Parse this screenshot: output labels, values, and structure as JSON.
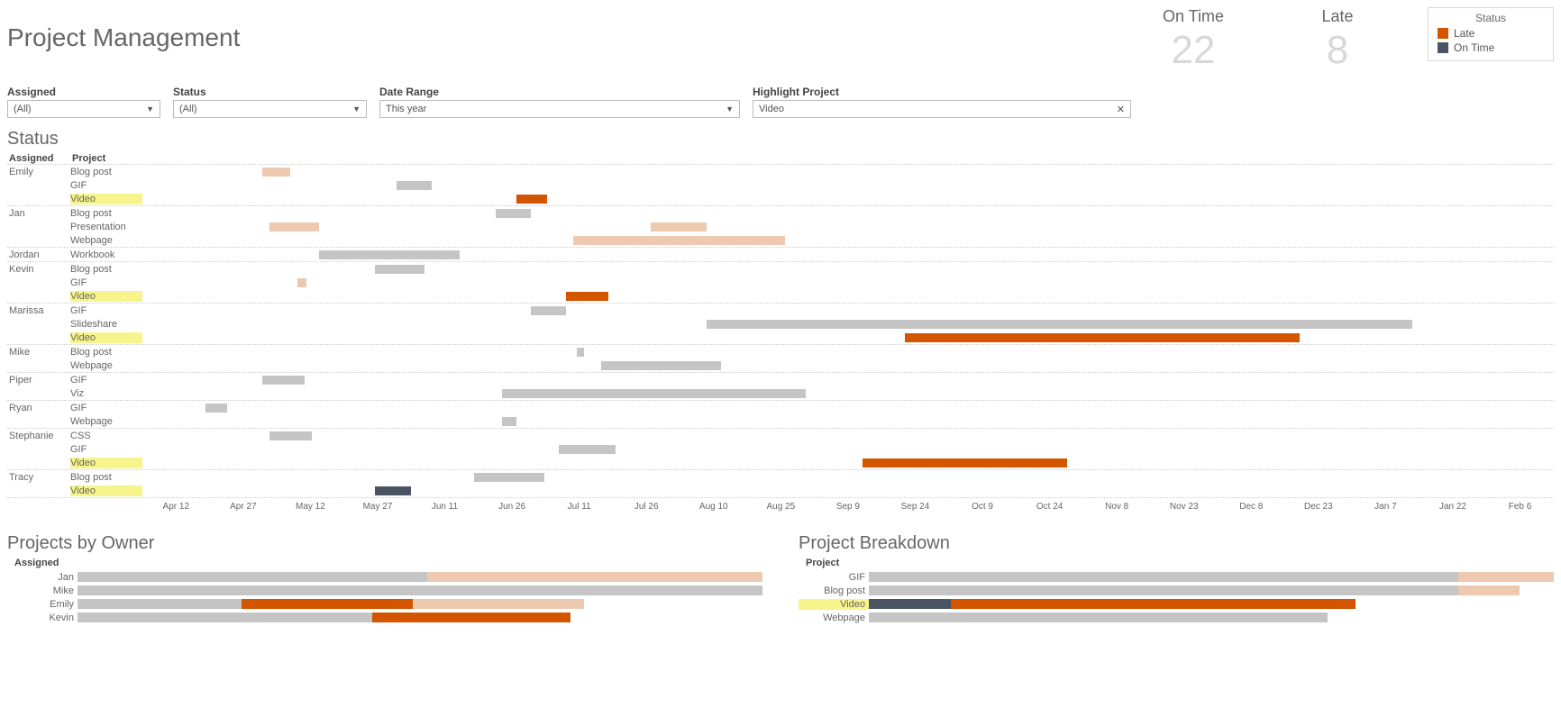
{
  "title": "Project Management",
  "kpis": {
    "ontime": {
      "label": "On Time",
      "value": "22"
    },
    "late": {
      "label": "Late",
      "value": "8"
    }
  },
  "legend": {
    "title": "Status",
    "items": [
      {
        "color": "late",
        "label": "Late"
      },
      {
        "color": "ontime",
        "label": "On Time"
      }
    ]
  },
  "filters": {
    "assigned": {
      "label": "Assigned",
      "value": "(All)"
    },
    "status": {
      "label": "Status",
      "value": "(All)"
    },
    "range": {
      "label": "Date Range",
      "value": "This year"
    },
    "highlight": {
      "label": "Highlight Project",
      "value": "Video"
    }
  },
  "sections": {
    "status": "Status",
    "owners": "Projects by Owner",
    "breakdown": "Project Breakdown"
  },
  "gantt": {
    "header_assigned": "Assigned",
    "header_project": "Project",
    "axis_ticks": [
      "Apr 12",
      "Apr 27",
      "May 12",
      "May 27",
      "Jun 11",
      "Jun 26",
      "Jul 11",
      "Jul 26",
      "Aug 10",
      "Aug 25",
      "Sep 9",
      "Sep 24",
      "Oct 9",
      "Oct 24",
      "Nov 8",
      "Nov 23",
      "Dec 8",
      "Dec 23",
      "Jan 7",
      "Jan 22",
      "Feb 6"
    ]
  },
  "chart_data": {
    "gantt": {
      "type": "bar",
      "x_axis_dates": [
        "Apr 12",
        "Apr 27",
        "May 12",
        "May 27",
        "Jun 11",
        "Jun 26",
        "Jul 11",
        "Jul 26",
        "Aug 10",
        "Aug 25",
        "Sep 9",
        "Sep 24",
        "Oct 9",
        "Oct 24",
        "Nov 8",
        "Nov 23",
        "Dec 8",
        "Dec 23",
        "Jan 7",
        "Jan 22",
        "Feb 6"
      ],
      "x_range_pct": [
        0,
        100
      ],
      "rows": [
        {
          "assignee": "Emily",
          "project": "Blog post",
          "highlight": false,
          "bars": [
            {
              "start_pct": 8.5,
              "width_pct": 2.0,
              "style": "peach"
            }
          ]
        },
        {
          "assignee": "",
          "project": "GIF",
          "highlight": false,
          "bars": [
            {
              "start_pct": 18.0,
              "width_pct": 2.5,
              "style": "gray"
            }
          ]
        },
        {
          "assignee": "",
          "project": "Video",
          "highlight": true,
          "bars": [
            {
              "start_pct": 26.5,
              "width_pct": 2.2,
              "style": "orange"
            }
          ]
        },
        {
          "assignee": "Jan",
          "project": "Blog post",
          "highlight": false,
          "bars": [
            {
              "start_pct": 25.0,
              "width_pct": 2.5,
              "style": "gray"
            }
          ]
        },
        {
          "assignee": "",
          "project": "Presentation",
          "highlight": false,
          "bars": [
            {
              "start_pct": 9.0,
              "width_pct": 3.5,
              "style": "peach"
            },
            {
              "start_pct": 36.0,
              "width_pct": 4.0,
              "style": "peach"
            }
          ]
        },
        {
          "assignee": "",
          "project": "Webpage",
          "highlight": false,
          "bars": [
            {
              "start_pct": 30.5,
              "width_pct": 15.0,
              "style": "peach"
            }
          ]
        },
        {
          "assignee": "Jordan",
          "project": "Workbook",
          "highlight": false,
          "bars": [
            {
              "start_pct": 12.5,
              "width_pct": 10.0,
              "style": "gray"
            }
          ]
        },
        {
          "assignee": "Kevin",
          "project": "Blog post",
          "highlight": false,
          "bars": [
            {
              "start_pct": 16.5,
              "width_pct": 3.5,
              "style": "gray"
            }
          ]
        },
        {
          "assignee": "",
          "project": "GIF",
          "highlight": false,
          "bars": [
            {
              "start_pct": 11.0,
              "width_pct": 0.6,
              "style": "peach"
            }
          ]
        },
        {
          "assignee": "",
          "project": "Video",
          "highlight": true,
          "bars": [
            {
              "start_pct": 30.0,
              "width_pct": 3.0,
              "style": "orange"
            }
          ]
        },
        {
          "assignee": "Marissa",
          "project": "GIF",
          "highlight": false,
          "bars": [
            {
              "start_pct": 27.5,
              "width_pct": 2.5,
              "style": "gray"
            }
          ]
        },
        {
          "assignee": "",
          "project": "Slideshare",
          "highlight": false,
          "bars": [
            {
              "start_pct": 40.0,
              "width_pct": 50.0,
              "style": "gray"
            }
          ]
        },
        {
          "assignee": "",
          "project": "Video",
          "highlight": true,
          "bars": [
            {
              "start_pct": 54.0,
              "width_pct": 28.0,
              "style": "orange"
            }
          ]
        },
        {
          "assignee": "Mike",
          "project": "Blog post",
          "highlight": false,
          "bars": [
            {
              "start_pct": 30.8,
              "width_pct": 0.5,
              "style": "gray"
            }
          ]
        },
        {
          "assignee": "",
          "project": "Webpage",
          "highlight": false,
          "bars": [
            {
              "start_pct": 32.5,
              "width_pct": 8.5,
              "style": "gray"
            }
          ]
        },
        {
          "assignee": "Piper",
          "project": "GIF",
          "highlight": false,
          "bars": [
            {
              "start_pct": 8.5,
              "width_pct": 3.0,
              "style": "gray"
            }
          ]
        },
        {
          "assignee": "",
          "project": "Viz",
          "highlight": false,
          "bars": [
            {
              "start_pct": 25.5,
              "width_pct": 21.5,
              "style": "gray"
            }
          ]
        },
        {
          "assignee": "Ryan",
          "project": "GIF",
          "highlight": false,
          "bars": [
            {
              "start_pct": 4.5,
              "width_pct": 1.5,
              "style": "gray"
            }
          ]
        },
        {
          "assignee": "",
          "project": "Webpage",
          "highlight": false,
          "bars": [
            {
              "start_pct": 25.5,
              "width_pct": 1.0,
              "style": "gray"
            }
          ]
        },
        {
          "assignee": "Stephanie",
          "project": "CSS",
          "highlight": false,
          "bars": [
            {
              "start_pct": 9.0,
              "width_pct": 3.0,
              "style": "gray"
            }
          ]
        },
        {
          "assignee": "",
          "project": "GIF",
          "highlight": false,
          "bars": [
            {
              "start_pct": 29.5,
              "width_pct": 4.0,
              "style": "gray"
            }
          ]
        },
        {
          "assignee": "",
          "project": "Video",
          "highlight": true,
          "bars": [
            {
              "start_pct": 51.0,
              "width_pct": 14.5,
              "style": "orange"
            }
          ]
        },
        {
          "assignee": "Tracy",
          "project": "Blog post",
          "highlight": false,
          "bars": [
            {
              "start_pct": 23.5,
              "width_pct": 5.0,
              "style": "gray"
            }
          ]
        },
        {
          "assignee": "",
          "project": "Video",
          "highlight": true,
          "bars": [
            {
              "start_pct": 16.5,
              "width_pct": 2.5,
              "style": "dark"
            }
          ]
        }
      ]
    },
    "owners": {
      "type": "bar",
      "header": "Assigned",
      "rows": [
        {
          "label": "Jan",
          "highlight": false,
          "segments": [
            {
              "style": "gray",
              "pct": 51
            },
            {
              "style": "peach",
              "pct": 49
            }
          ]
        },
        {
          "label": "Mike",
          "highlight": false,
          "segments": [
            {
              "style": "gray",
              "pct": 100
            }
          ]
        },
        {
          "label": "Emily",
          "highlight": false,
          "segments": [
            {
              "style": "gray",
              "pct": 24
            },
            {
              "style": "orange",
              "pct": 25
            },
            {
              "style": "peach",
              "pct": 25
            }
          ]
        },
        {
          "label": "Kevin",
          "highlight": false,
          "segments": [
            {
              "style": "gray",
              "pct": 43
            },
            {
              "style": "orange",
              "pct": 29
            }
          ]
        }
      ]
    },
    "breakdown": {
      "type": "bar",
      "header": "Project",
      "rows": [
        {
          "label": "GIF",
          "highlight": false,
          "segments": [
            {
              "style": "gray",
              "pct": 86
            },
            {
              "style": "peach",
              "pct": 14
            }
          ]
        },
        {
          "label": "Blog post",
          "highlight": false,
          "segments": [
            {
              "style": "gray",
              "pct": 86
            },
            {
              "style": "peach",
              "pct": 9
            }
          ]
        },
        {
          "label": "Video",
          "highlight": true,
          "segments": [
            {
              "style": "dark",
              "pct": 12
            },
            {
              "style": "orange",
              "pct": 59
            }
          ]
        },
        {
          "label": "Webpage",
          "highlight": false,
          "segments": [
            {
              "style": "gray",
              "pct": 67
            }
          ]
        }
      ]
    }
  }
}
